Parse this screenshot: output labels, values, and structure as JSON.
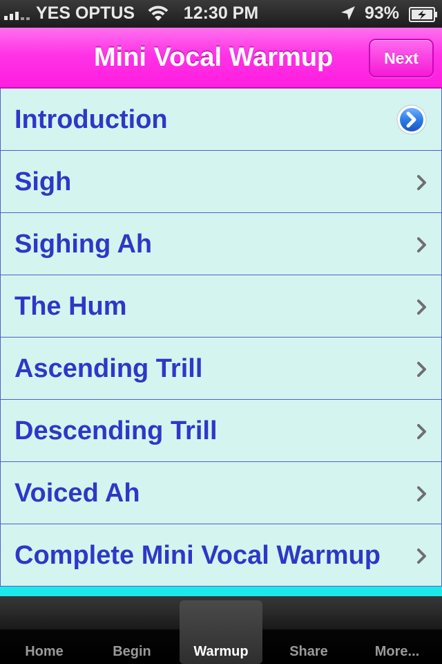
{
  "status_bar": {
    "carrier": "YES OPTUS",
    "time": "12:30 PM",
    "battery": "93%",
    "icons": [
      "signal-icon",
      "wifi-icon",
      "location-arrow-icon",
      "battery-charging-icon"
    ]
  },
  "nav": {
    "title": "Mini Vocal Warmup",
    "next_label": "Next",
    "accent_color": "#ff33e6"
  },
  "list": {
    "items": [
      {
        "label": "Introduction",
        "accessory": "detail-disclosure-icon"
      },
      {
        "label": "Sigh",
        "accessory": "chevron-right-icon"
      },
      {
        "label": "Sighing Ah",
        "accessory": "chevron-right-icon"
      },
      {
        "label": "The Hum",
        "accessory": "chevron-right-icon"
      },
      {
        "label": "Ascending Trill",
        "accessory": "chevron-right-icon"
      },
      {
        "label": "Descending Trill",
        "accessory": "chevron-right-icon"
      },
      {
        "label": "Voiced Ah",
        "accessory": "chevron-right-icon"
      },
      {
        "label": "Complete Mini Vocal Warmup",
        "accessory": "chevron-right-icon"
      }
    ],
    "text_color": "#2f37c7",
    "row_color": "#d4f4ef"
  },
  "tab_bar": {
    "tabs": [
      {
        "label": "Home",
        "selected": false
      },
      {
        "label": "Begin",
        "selected": false
      },
      {
        "label": "Warmup",
        "selected": true
      },
      {
        "label": "Share",
        "selected": false
      },
      {
        "label": "More...",
        "selected": false
      }
    ]
  }
}
